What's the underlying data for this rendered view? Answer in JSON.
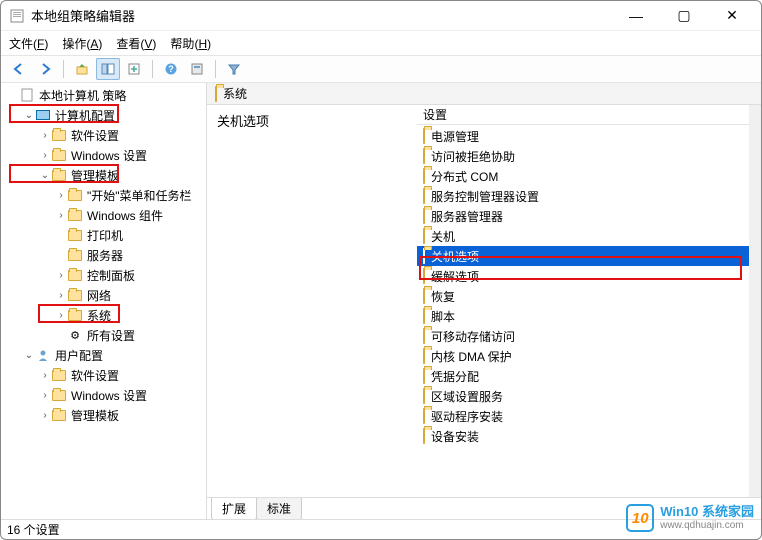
{
  "window": {
    "title": "本地组策略编辑器",
    "controls": {
      "minimize": "—",
      "maximize": "▢",
      "close": "✕"
    }
  },
  "menubar": [
    {
      "label": "文件",
      "accel": "F"
    },
    {
      "label": "操作",
      "accel": "A"
    },
    {
      "label": "查看",
      "accel": "V"
    },
    {
      "label": "帮助",
      "accel": "H"
    }
  ],
  "tree": {
    "root": "本地计算机 策略",
    "nodes": [
      {
        "level": 1,
        "expand": "open",
        "label": "计算机配置",
        "icon": "computer"
      },
      {
        "level": 2,
        "expand": "closed",
        "label": "软件设置",
        "icon": "folder"
      },
      {
        "level": 2,
        "expand": "closed",
        "label": "Windows 设置",
        "icon": "folder"
      },
      {
        "level": 2,
        "expand": "open",
        "label": "管理模板",
        "icon": "folder"
      },
      {
        "level": 3,
        "expand": "closed",
        "label": "\"开始\"菜单和任务栏",
        "icon": "folder"
      },
      {
        "level": 3,
        "expand": "closed",
        "label": "Windows 组件",
        "icon": "folder"
      },
      {
        "level": 3,
        "expand": "none",
        "label": "打印机",
        "icon": "folder"
      },
      {
        "level": 3,
        "expand": "none",
        "label": "服务器",
        "icon": "folder"
      },
      {
        "level": 3,
        "expand": "closed",
        "label": "控制面板",
        "icon": "folder"
      },
      {
        "level": 3,
        "expand": "closed",
        "label": "网络",
        "icon": "folder"
      },
      {
        "level": 3,
        "expand": "closed",
        "label": "系统",
        "icon": "folder"
      },
      {
        "level": 3,
        "expand": "none",
        "label": "所有设置",
        "icon": "gear"
      },
      {
        "level": 1,
        "expand": "open",
        "label": "用户配置",
        "icon": "user"
      },
      {
        "level": 2,
        "expand": "closed",
        "label": "软件设置",
        "icon": "folder"
      },
      {
        "level": 2,
        "expand": "closed",
        "label": "Windows 设置",
        "icon": "folder"
      },
      {
        "level": 2,
        "expand": "closed",
        "label": "管理模板",
        "icon": "folder"
      }
    ]
  },
  "right": {
    "header": "系统",
    "desc": "关机选项",
    "column": "设置",
    "items": [
      {
        "label": "电源管理",
        "selected": false
      },
      {
        "label": "访问被拒绝协助",
        "selected": false
      },
      {
        "label": "分布式 COM",
        "selected": false
      },
      {
        "label": "服务控制管理器设置",
        "selected": false
      },
      {
        "label": "服务器管理器",
        "selected": false
      },
      {
        "label": "关机",
        "selected": false
      },
      {
        "label": "关机选项",
        "selected": true
      },
      {
        "label": "缓解选项",
        "selected": false
      },
      {
        "label": "恢复",
        "selected": false
      },
      {
        "label": "脚本",
        "selected": false
      },
      {
        "label": "可移动存储访问",
        "selected": false
      },
      {
        "label": "内核 DMA 保护",
        "selected": false
      },
      {
        "label": "凭据分配",
        "selected": false
      },
      {
        "label": "区域设置服务",
        "selected": false
      },
      {
        "label": "驱动程序安装",
        "selected": false
      },
      {
        "label": "设备安装",
        "selected": false
      }
    ],
    "tabs": {
      "active": "扩展",
      "inactive": "标准"
    }
  },
  "status": "16 个设置",
  "watermark": {
    "logo": "10",
    "line1": "Win10 系统家园",
    "line2": "www.qdhuajin.com"
  }
}
